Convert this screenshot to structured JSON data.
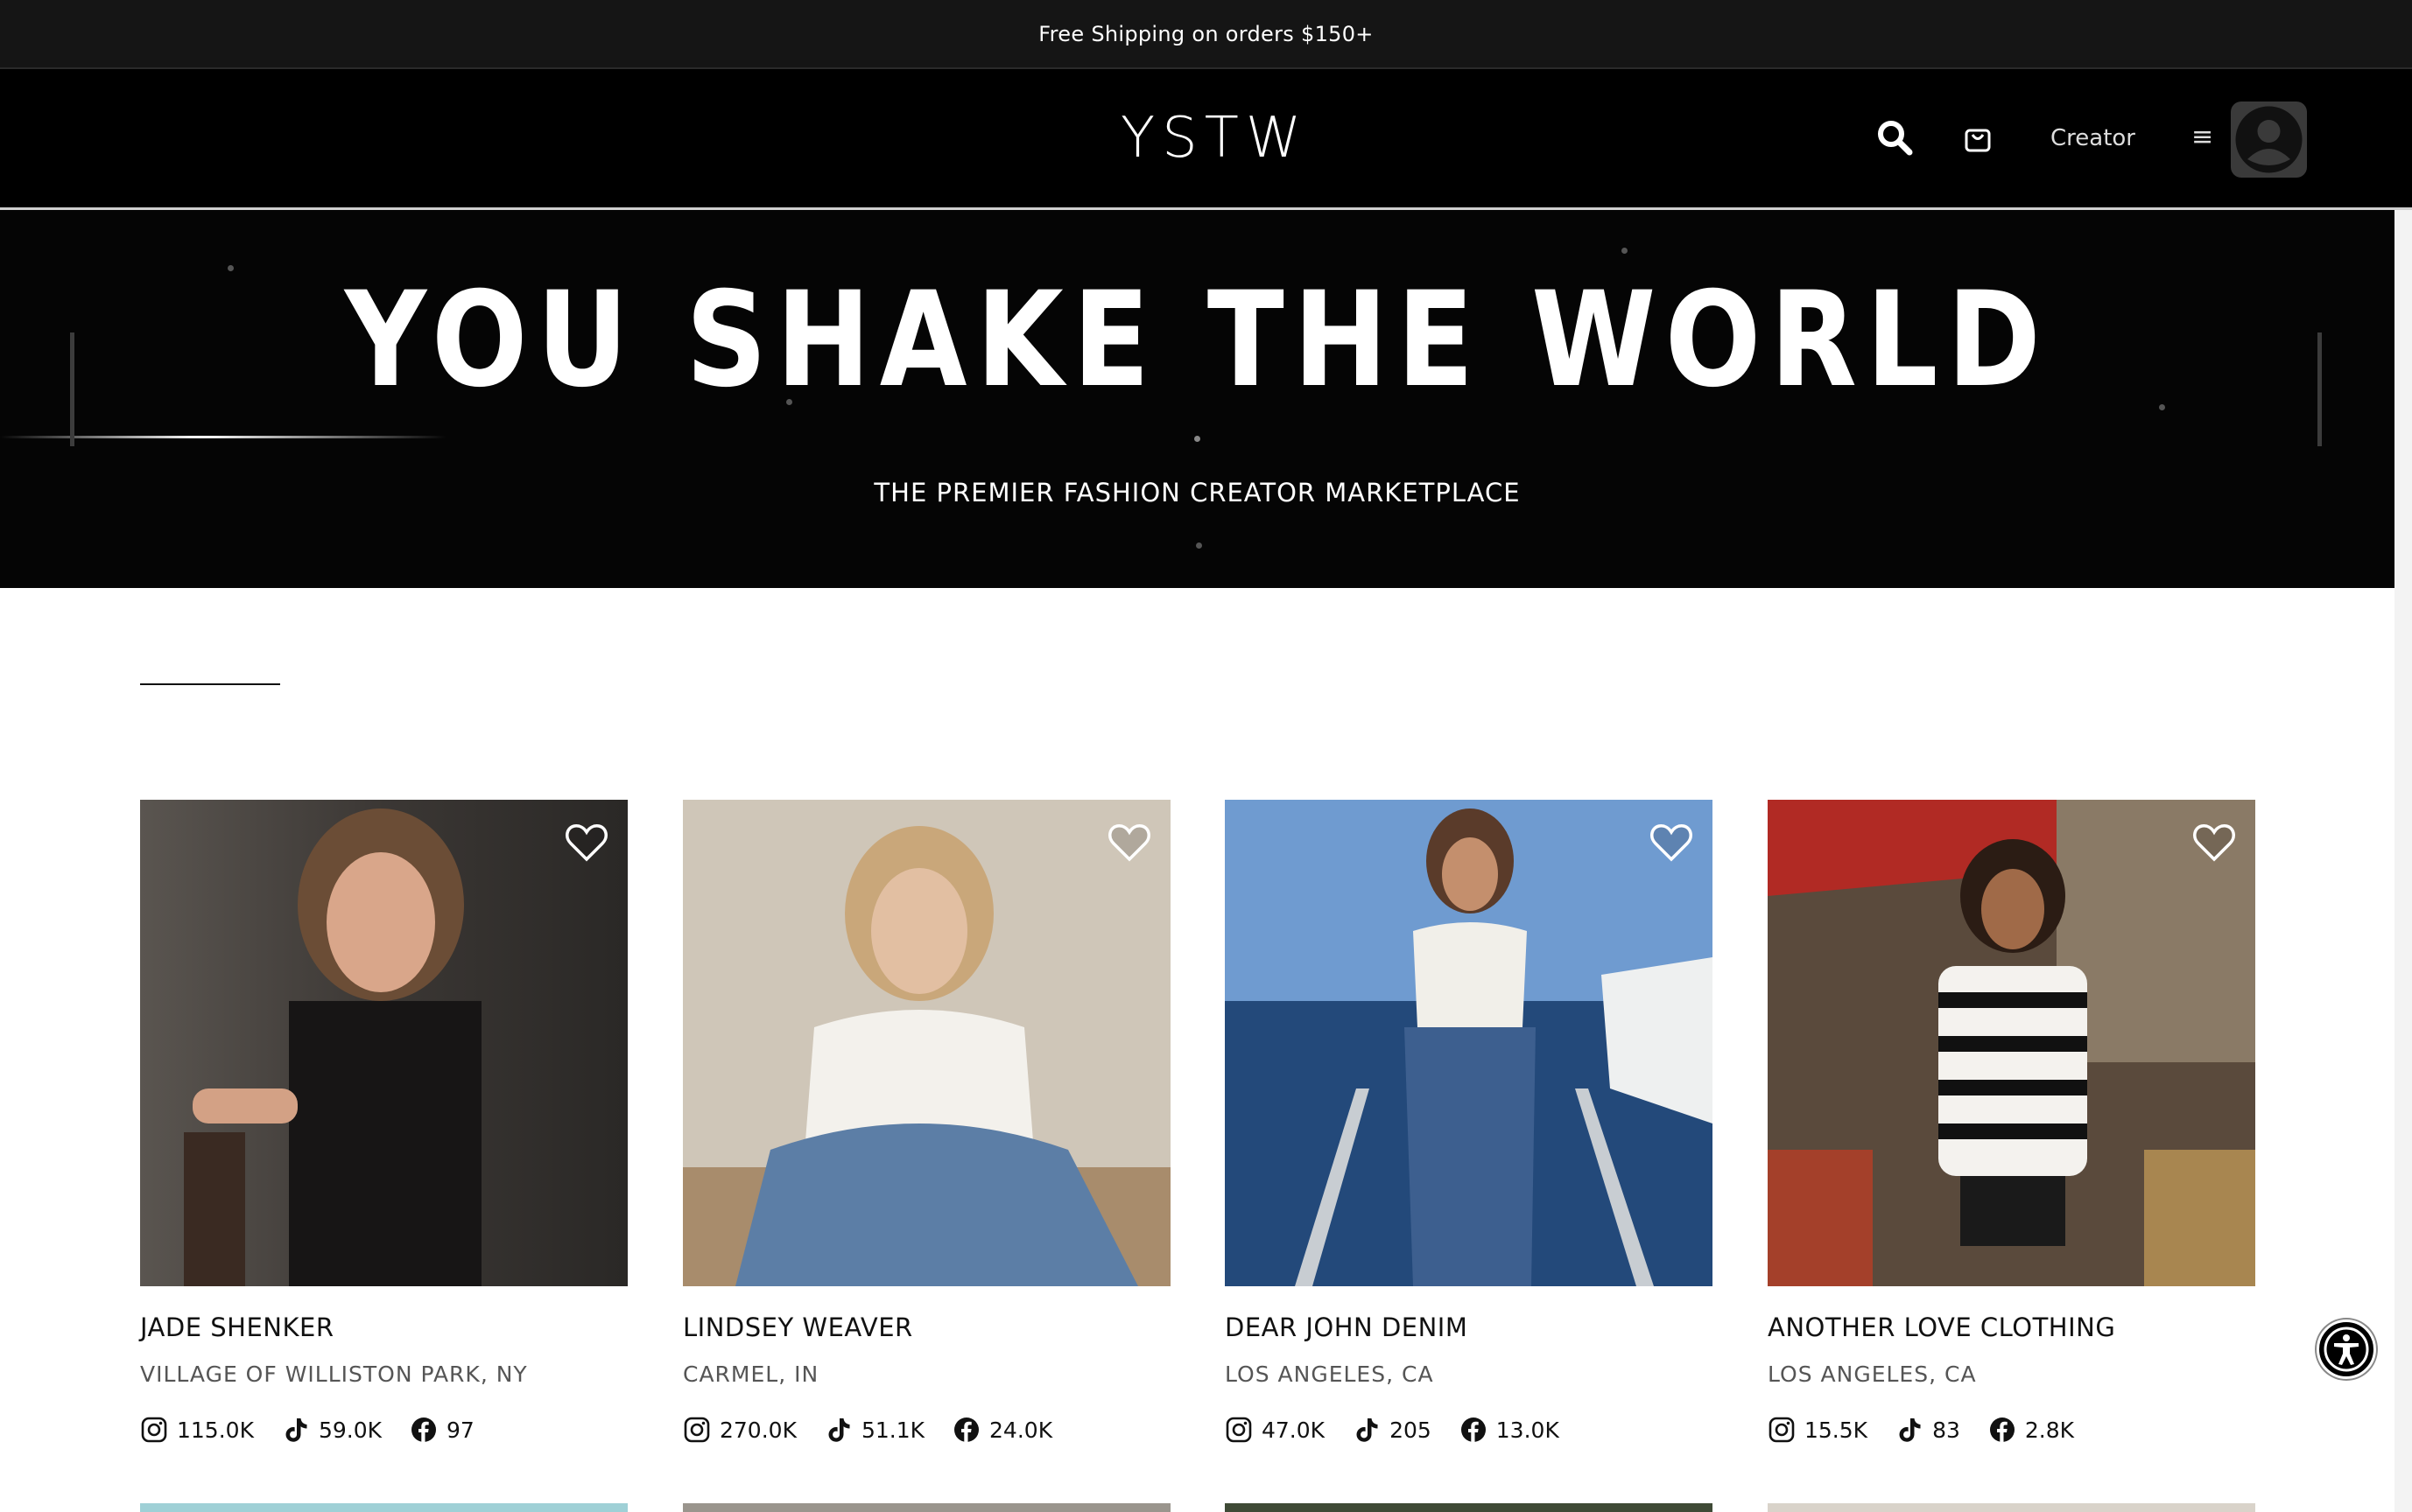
{
  "announcement": {
    "text": "Free Shipping on orders $150+"
  },
  "header": {
    "logo": "YSTW",
    "search_icon": "search-icon",
    "cart_icon": "shopping-bag-icon",
    "creator_label": "Creator",
    "menu_glyph": "≡",
    "avatar_icon": "user-avatar-icon"
  },
  "hero": {
    "title": "YOU SHAKE THE WORLD",
    "subtitle": "THE PREMIER FASHION CREATOR MARKETPLACE"
  },
  "creators": [
    {
      "name": "JADE SHENKER",
      "location": "VILLAGE OF WILLISTON PARK, NY",
      "instagram": "115.0K",
      "tiktok": "59.0K",
      "facebook": "97"
    },
    {
      "name": "LINDSEY WEAVER",
      "location": "CARMEL, IN",
      "instagram": "270.0K",
      "tiktok": "51.1K",
      "facebook": "24.0K"
    },
    {
      "name": "DEAR JOHN DENIM",
      "location": "LOS ANGELES, CA",
      "instagram": "47.0K",
      "tiktok": "205",
      "facebook": "13.0K"
    },
    {
      "name": "ANOTHER LOVE CLOTHING",
      "location": "LOS ANGELES, CA",
      "instagram": "15.5K",
      "tiktok": "83",
      "facebook": "2.8K"
    }
  ],
  "colors": {
    "header_bg": "#000000",
    "announce_bg": "#151515",
    "text": "#111111",
    "muted": "#555555"
  }
}
